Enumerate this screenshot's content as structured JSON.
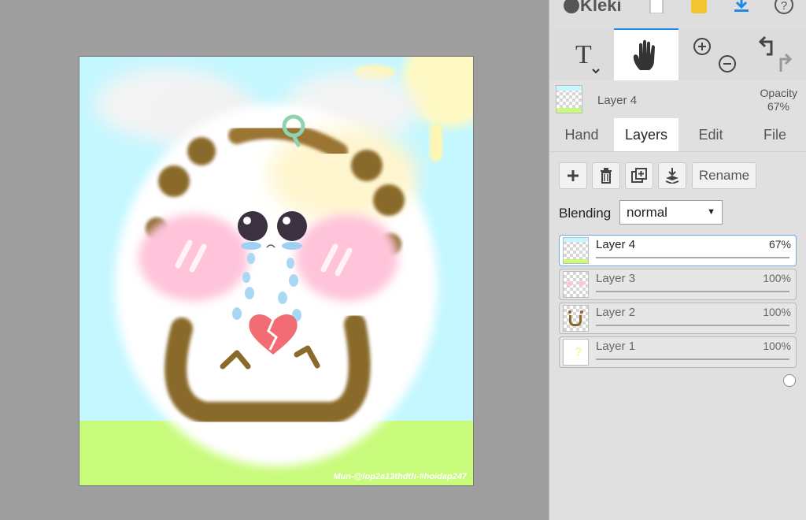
{
  "app": {
    "name": "Kleki"
  },
  "toolbar": {
    "top_icons": [
      "new-image-icon",
      "open-folder-icon",
      "download-icon",
      "help-icon"
    ]
  },
  "tools": {
    "active": "hand",
    "items": [
      "text-tool-icon",
      "hand-tool-icon",
      "zoom-in-icon",
      "zoom-out-icon",
      "undo-icon",
      "redo-icon"
    ]
  },
  "current_layer": {
    "name": "Layer 4",
    "opacity_label": "Opacity",
    "opacity_value": "67%"
  },
  "tabs": [
    {
      "label": "Hand",
      "active": false
    },
    {
      "label": "Layers",
      "active": true
    },
    {
      "label": "Edit",
      "active": false
    },
    {
      "label": "File",
      "active": false
    }
  ],
  "layers_panel": {
    "rename_label": "Rename",
    "blending_label": "Blending",
    "blending_value": "normal"
  },
  "layers": [
    {
      "name": "Layer 4",
      "opacity": "67%",
      "level": 0.67,
      "selected": true
    },
    {
      "name": "Layer 3",
      "opacity": "100%",
      "level": 1.0,
      "selected": false
    },
    {
      "name": "Layer 2",
      "opacity": "100%",
      "level": 1.0,
      "selected": false
    },
    {
      "name": "Layer 1",
      "opacity": "100%",
      "level": 1.0,
      "selected": false
    }
  ],
  "canvas": {
    "signature": "Mun-@lop2a13thdth-#hoidap247"
  },
  "colors": {
    "accent": "#1e88e5",
    "sky": "#c4f7ff",
    "grass": "#c8fb7b",
    "blush": "#ffc4da",
    "outline": "#8a6a2a"
  }
}
